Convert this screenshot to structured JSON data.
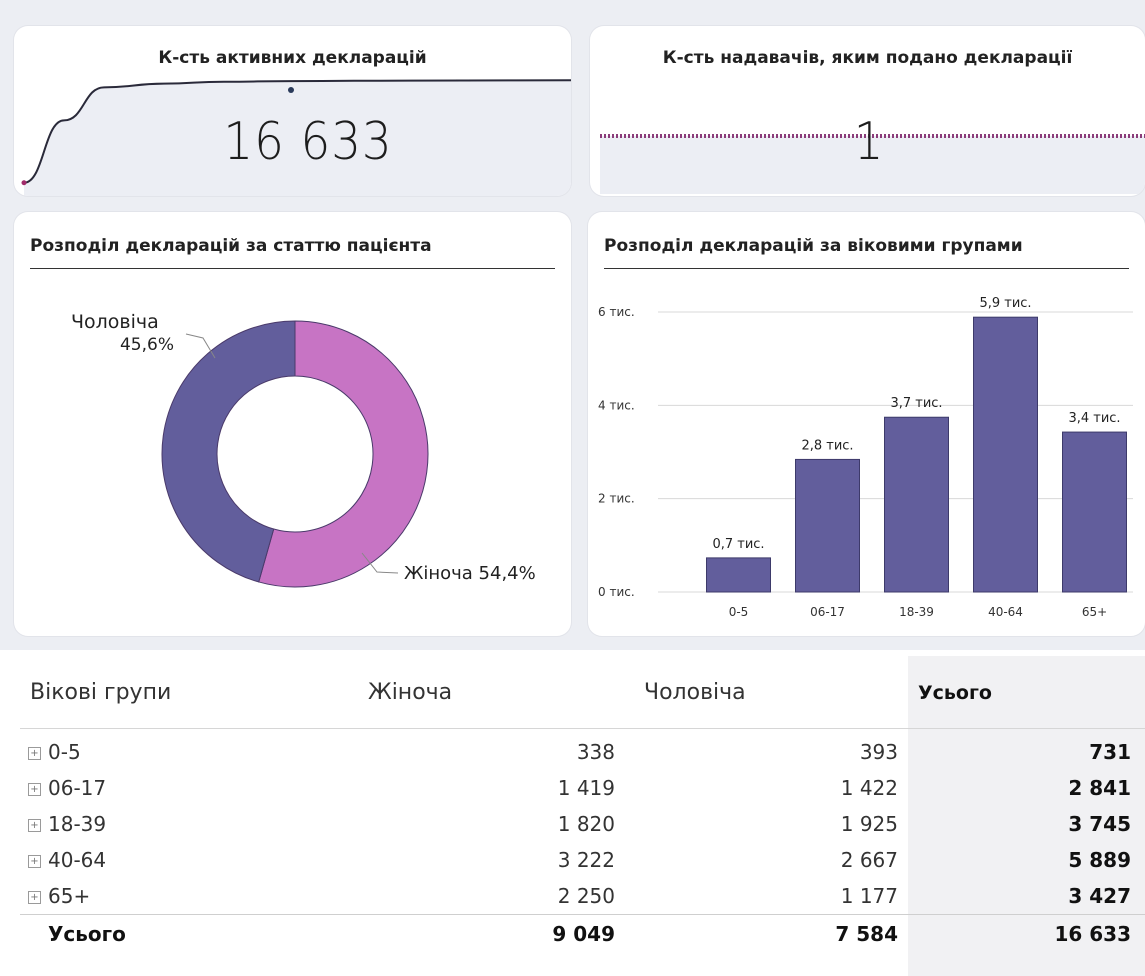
{
  "kpi1": {
    "title": "К-сть активних декларацій",
    "value": "16 633"
  },
  "kpi2": {
    "title": "К-сть надавачів, яким подано декларації",
    "value": "1"
  },
  "gender": {
    "title": "Розподіл декларацій за статтю пацієнта",
    "male_label": "Чоловіча",
    "male_pct": "45,6%",
    "female_label": "Жіноча 54,4%"
  },
  "age": {
    "title": "Розподіл декларацій за віковими групами"
  },
  "colors": {
    "female": "#c774c4",
    "male": "#625e9c",
    "bar": "#625e9c"
  },
  "chart_data": [
    {
      "type": "line",
      "series": [
        {
          "values": [
            0.2,
            10.2,
            15.5,
            16.1,
            16.4,
            16.5,
            16.55,
            16.6,
            16.63
          ]
        }
      ],
      "note_value_shown": "16 633"
    },
    {
      "type": "line",
      "series": [
        {
          "values": [
            1,
            1,
            1,
            1,
            1,
            1,
            1,
            1,
            1
          ]
        }
      ]
    },
    {
      "type": "pie",
      "title": "Розподіл декларацій за статтю пацієнта",
      "categories": [
        "Жіноча",
        "Чоловіча"
      ],
      "values": [
        54.4,
        45.6
      ]
    },
    {
      "type": "bar",
      "title": "Розподіл декларацій за віковими групами",
      "categories": [
        "0-5",
        "06-17",
        "18-39",
        "40-64",
        "65+"
      ],
      "values": [
        0.731,
        2.841,
        3.745,
        5.889,
        3.427
      ],
      "data_labels": [
        "0,7 тис.",
        "2,8 тис.",
        "3,7 тис.",
        "5,9 тис.",
        "3,4 тис."
      ],
      "yticks": [
        0,
        2,
        4,
        6
      ],
      "ytick_labels": [
        "0 тис.",
        "2 тис.",
        "4 тис.",
        "6 тис."
      ],
      "ylim": [
        0,
        6.6
      ]
    }
  ],
  "table": {
    "headers": [
      "Вікові групи",
      "Жіноча",
      "Чоловіча",
      "Усього"
    ],
    "rows": [
      {
        "group": "0-5",
        "female": "338",
        "male": "393",
        "total": "731"
      },
      {
        "group": "06-17",
        "female": "1 419",
        "male": "1 422",
        "total": "2 841"
      },
      {
        "group": "18-39",
        "female": "1 820",
        "male": "1 925",
        "total": "3 745"
      },
      {
        "group": "40-64",
        "female": "3 222",
        "male": "2 667",
        "total": "5 889"
      },
      {
        "group": "65+",
        "female": "2 250",
        "male": "1 177",
        "total": "3 427"
      }
    ],
    "total_row": {
      "label": "Усього",
      "female": "9 049",
      "male": "7 584",
      "total": "16 633"
    }
  }
}
